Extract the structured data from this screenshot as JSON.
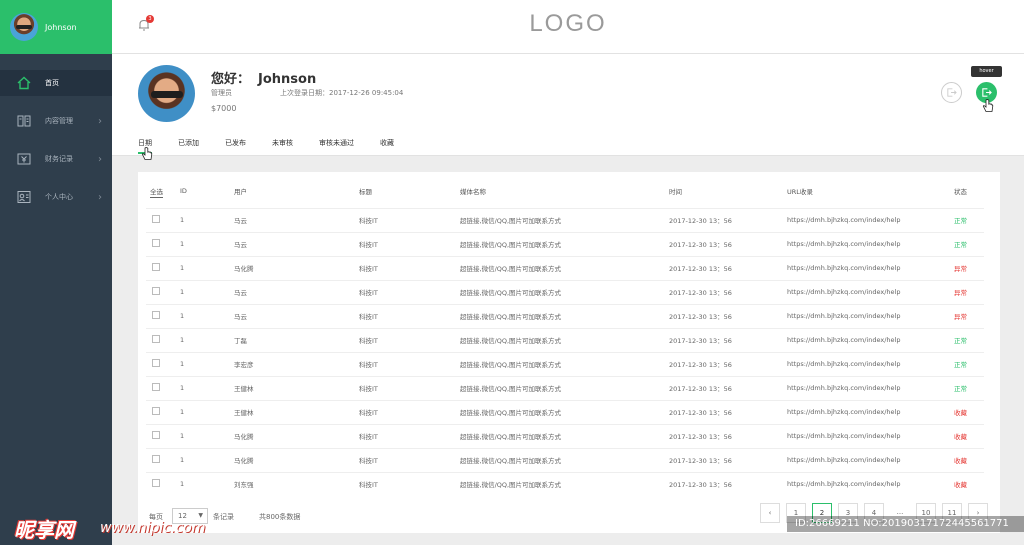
{
  "sidebar": {
    "username": "Johnson",
    "items": [
      {
        "label": "首页",
        "icon": "home-icon"
      },
      {
        "label": "内容管理",
        "icon": "book-icon"
      },
      {
        "label": "财务记录",
        "icon": "finance-icon"
      },
      {
        "label": "个人中心",
        "icon": "user-card-icon"
      }
    ]
  },
  "header": {
    "logo": "LOGO",
    "notification_count": "3"
  },
  "profile": {
    "greeting": "您好：",
    "name": "Johnson",
    "role": "管理员",
    "last_login": "上次登录日期：2017-12-26 09:45:04",
    "balance": "$7000",
    "tooltip": "hover"
  },
  "tabs": [
    "日期",
    "已添加",
    "已发布",
    "未审核",
    "审核未通过",
    "收藏"
  ],
  "table": {
    "headers": [
      "全选",
      "ID",
      "用户",
      "标题",
      "媒体名称",
      "时间",
      "URL收录",
      "状态"
    ],
    "rows": [
      {
        "id": "1",
        "user": "马云",
        "title": "科技IT",
        "media": "超链接,微信/QQ,图片可加联系方式",
        "time": "2017-12-30  13：56",
        "url": "https://dmh.bjhzkq.com/index/help",
        "status": "正常",
        "ok": true
      },
      {
        "id": "1",
        "user": "马云",
        "title": "科技IT",
        "media": "超链接,微信/QQ,图片可加联系方式",
        "time": "2017-12-30  13：56",
        "url": "https://dmh.bjhzkq.com/index/help",
        "status": "正常",
        "ok": true
      },
      {
        "id": "1",
        "user": "马化腾",
        "title": "科技IT",
        "media": "超链接,微信/QQ,图片可加联系方式",
        "time": "2017-12-30  13：56",
        "url": "https://dmh.bjhzkq.com/index/help",
        "status": "异常",
        "ok": false
      },
      {
        "id": "1",
        "user": "马云",
        "title": "科技IT",
        "media": "超链接,微信/QQ,图片可加联系方式",
        "time": "2017-12-30  13：56",
        "url": "https://dmh.bjhzkq.com/index/help",
        "status": "异常",
        "ok": false
      },
      {
        "id": "1",
        "user": "马云",
        "title": "科技IT",
        "media": "超链接,微信/QQ,图片可加联系方式",
        "time": "2017-12-30  13：56",
        "url": "https://dmh.bjhzkq.com/index/help",
        "status": "异常",
        "ok": false
      },
      {
        "id": "1",
        "user": "丁磊",
        "title": "科技IT",
        "media": "超链接,微信/QQ,图片可加联系方式",
        "time": "2017-12-30  13：56",
        "url": "https://dmh.bjhzkq.com/index/help",
        "status": "正常",
        "ok": true
      },
      {
        "id": "1",
        "user": "李宏彦",
        "title": "科技IT",
        "media": "超链接,微信/QQ,图片可加联系方式",
        "time": "2017-12-30  13：56",
        "url": "https://dmh.bjhzkq.com/index/help",
        "status": "正常",
        "ok": true
      },
      {
        "id": "1",
        "user": "王健林",
        "title": "科技IT",
        "media": "超链接,微信/QQ,图片可加联系方式",
        "time": "2017-12-30  13：56",
        "url": "https://dmh.bjhzkq.com/index/help",
        "status": "正常",
        "ok": true
      },
      {
        "id": "1",
        "user": "王健林",
        "title": "科技IT",
        "media": "超链接,微信/QQ,图片可加联系方式",
        "time": "2017-12-30  13：56",
        "url": "https://dmh.bjhzkq.com/index/help",
        "status": "收藏",
        "ok": false
      },
      {
        "id": "1",
        "user": "马化腾",
        "title": "科技IT",
        "media": "超链接,微信/QQ,图片可加联系方式",
        "time": "2017-12-30  13：56",
        "url": "https://dmh.bjhzkq.com/index/help",
        "status": "收藏",
        "ok": false
      },
      {
        "id": "1",
        "user": "马化腾",
        "title": "科技IT",
        "media": "超链接,微信/QQ,图片可加联系方式",
        "time": "2017-12-30  13：56",
        "url": "https://dmh.bjhzkq.com/index/help",
        "status": "收藏",
        "ok": false
      },
      {
        "id": "1",
        "user": "刘东强",
        "title": "科技IT",
        "media": "超链接,微信/QQ,图片可加联系方式",
        "time": "2017-12-30  13：56",
        "url": "https://dmh.bjhzkq.com/index/help",
        "status": "收藏",
        "ok": false
      }
    ]
  },
  "footer": {
    "per_page_label": "每页",
    "per_page_value": "12",
    "records_label": "条记录",
    "total_label": "共800条数据",
    "pages": [
      "1",
      "2",
      "3",
      "4",
      "...",
      "10",
      "11"
    ],
    "current_page": "2"
  },
  "watermark": {
    "left": "昵享网",
    "url": "www.nipic.com",
    "right": "ID:26669211 NO:20190317172445561771"
  },
  "colors": {
    "accent": "#2bbf6b",
    "sidebar": "#2f3e4c",
    "error": "#e53935"
  }
}
